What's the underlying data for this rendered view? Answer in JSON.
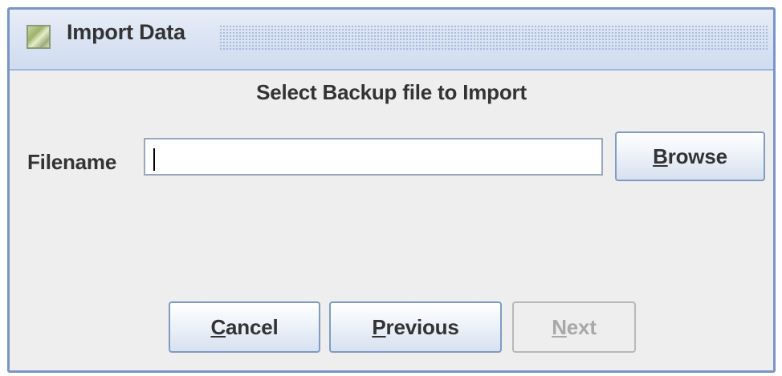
{
  "window": {
    "title": "Import Data",
    "icon": "app-window-icon"
  },
  "content": {
    "heading": "Select Backup file to Import",
    "filename_label": "Filename",
    "filename_value": "",
    "filename_placeholder": ""
  },
  "buttons": {
    "browse": {
      "mnemonic": "B",
      "rest": "rowse",
      "enabled": true
    },
    "cancel": {
      "mnemonic": "C",
      "rest": "ancel",
      "enabled": true
    },
    "previous": {
      "mnemonic": "P",
      "rest": "revious",
      "enabled": true
    },
    "next": {
      "mnemonic": "N",
      "rest": "ext",
      "enabled": false
    }
  },
  "colors": {
    "window_border": "#7895c9",
    "titlebar_top": "#e7edf8",
    "titlebar_bottom": "#cfdbef",
    "panel_background": "#eeeeee",
    "text": "#333333",
    "disabled_text": "#a8a8a8"
  }
}
